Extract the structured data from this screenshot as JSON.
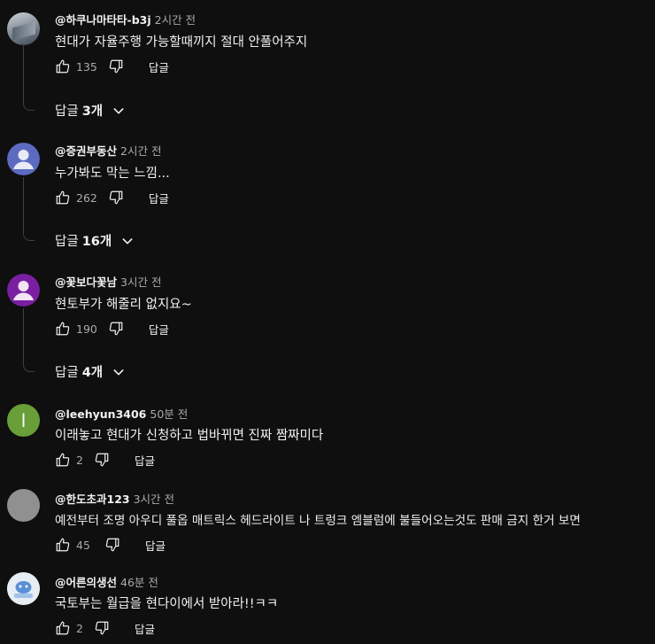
{
  "comments": [
    {
      "user": "@하쿠나마타타-b3j",
      "time": "2시간 전",
      "text": "현대가 자율주행 가능할때끼지 절대 안풀어주지",
      "likes": "135",
      "reply_label": "답글",
      "replies_label": "답글",
      "replies_count": "3개",
      "avatar": "photo"
    },
    {
      "user": "@증권부동산",
      "time": "2시간 전",
      "text": "누가봐도 막는 느낌...",
      "likes": "262",
      "reply_label": "답글",
      "replies_label": "답글",
      "replies_count": "16개",
      "avatar": "person",
      "avatar_color": "#5c6bc0"
    },
    {
      "user": "@꽃보다꽃남",
      "time": "3시간 전",
      "text": "현토부가 해줄리 없지요~",
      "likes": "190",
      "reply_label": "답글",
      "replies_label": "답글",
      "replies_count": "4개",
      "avatar": "person",
      "avatar_color": "#7b1fa2"
    },
    {
      "user": "@leehyun3406",
      "time": "50분 전",
      "text": "이래놓고 현대가 신청하고 법바뀌면 진짜 짬짜미다",
      "likes": "2",
      "reply_label": "답글",
      "avatar": "letter",
      "avatar_letter": "l",
      "avatar_color": "#689f38"
    },
    {
      "user": "@한도초과123",
      "time": "3시간 전",
      "text": "예전부터 조명 아우디  풀옵  매트릭스 헤드라이트 나 트렁크 엠블럼에 불들어오는것도 판매 금지 한거 보면",
      "likes": "45",
      "reply_label": "답글",
      "avatar": "grey"
    },
    {
      "user": "@어른의생선",
      "time": "46분 전",
      "text": "국토부는 월급을 현다이에서 받아라!!ㅋㅋ",
      "likes": "2",
      "reply_label": "답글",
      "avatar": "cartoon"
    }
  ]
}
